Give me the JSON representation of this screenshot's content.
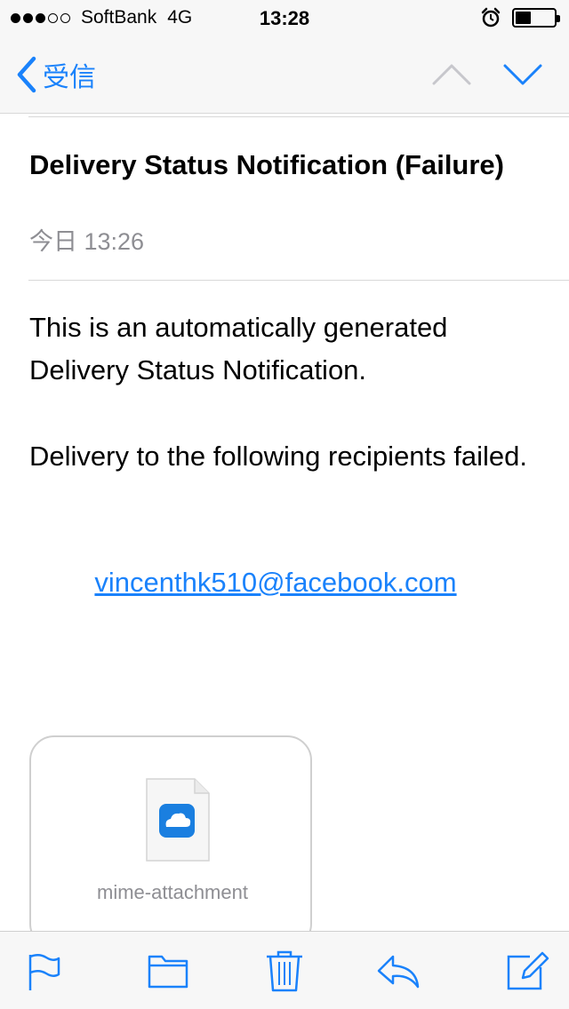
{
  "status_bar": {
    "carrier": "SoftBank",
    "network": "4G",
    "time": "13:28",
    "signal_bars_filled": 3,
    "signal_bars_total": 5,
    "battery_level": 0.4
  },
  "nav": {
    "back_label": "受信",
    "up_icon": "chevron-up-icon",
    "down_icon": "chevron-down-icon"
  },
  "message": {
    "subject": "Delivery Status Notification (Failure)",
    "date": "今日 13:26",
    "body_paragraph_1": "This is an automatically generated Delivery Status Notification.",
    "body_paragraph_2": "Delivery to the following recipients failed.",
    "recipient_link": "vincenthk510@facebook.com"
  },
  "attachment": {
    "name": "mime-attachment",
    "icon": "cloud-icon"
  },
  "toolbar": {
    "items": [
      "flag-icon",
      "folder-icon",
      "trash-icon",
      "reply-icon",
      "compose-icon"
    ]
  },
  "colors": {
    "accent": "#1a82fb",
    "secondary_text": "#8e8e93",
    "disabled_icon": "#c7c7cc",
    "bar_background": "#f7f7f7"
  }
}
